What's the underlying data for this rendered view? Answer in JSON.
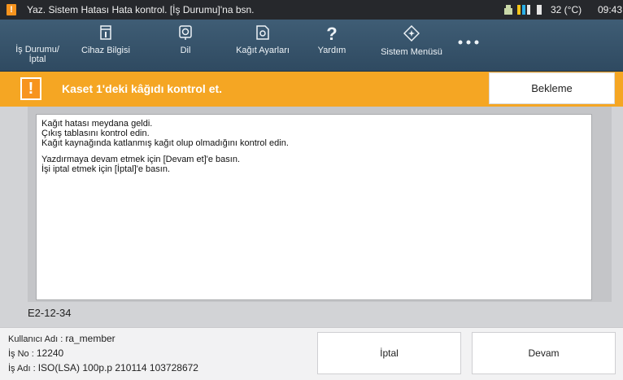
{
  "status_bar": {
    "title": "Yaz. Sistem Hatası Hata kontrol. [İş Durumu]'na bsn.",
    "temperature": "32 (°C)",
    "time": "09:43"
  },
  "toolbar": {
    "job_status_line1": "İş Durumu/",
    "job_status_line2": "İptal",
    "device_info": "Cihaz Bilgisi",
    "language": "Dil",
    "paper_settings": "Kağıt Ayarları",
    "help": "Yardım",
    "system_menu": "Sistem Menüsü"
  },
  "alert": {
    "message": "Kaset 1'deki kâğıdı kontrol et.",
    "wait_button": "Bekleme"
  },
  "message_lines": [
    "Kağıt hatası meydana geldi.",
    "Çıkış tablasını kontrol edin.",
    "Kağıt kaynağında katlanmış kağıt olup olmadığını kontrol edin.",
    "Yazdırmaya devam etmek için [Devam et]'e basın.",
    "İşi iptal etmek için [İptal]'e basın."
  ],
  "error_code": "E2-12-34",
  "footer": {
    "user_label": "Kullanıcı Adı :",
    "user_value": "ra_member",
    "job_no_label": "İş No :",
    "job_no_value": "12240",
    "job_name_label": "İş Adı :",
    "job_name_value": "ISO(LSA) 100p.p 210114 103728672",
    "cancel_button": "İptal",
    "continue_button": "Devam"
  },
  "colors": {
    "alert_orange": "#f5a623",
    "toolbar_blue": "#35516a",
    "status_bar": "#26282c"
  }
}
